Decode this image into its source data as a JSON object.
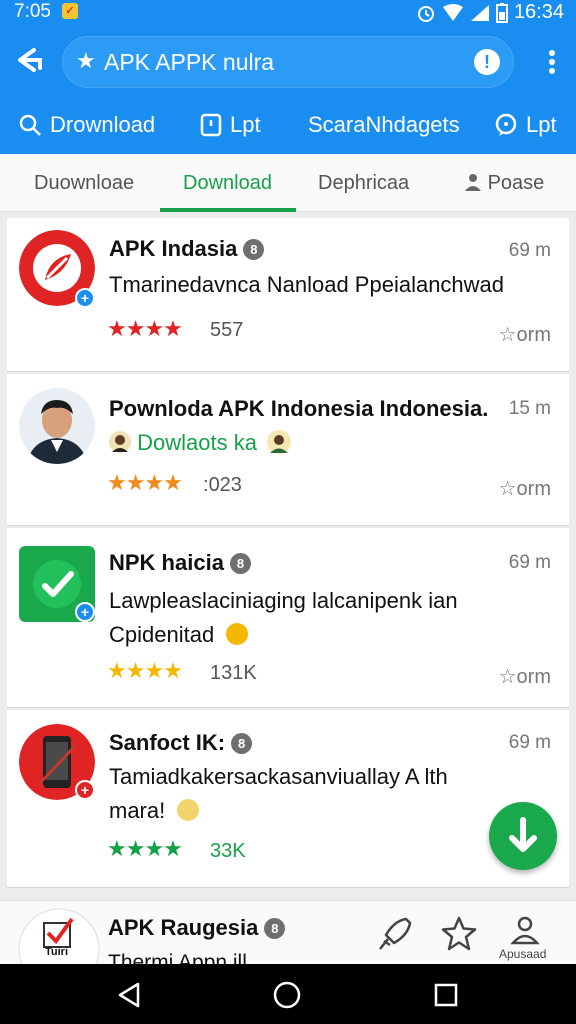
{
  "status": {
    "time": "7:05",
    "clock": "16:34"
  },
  "search": {
    "query": "APK APPK nulra"
  },
  "quickbar": [
    {
      "label": "Drownload",
      "icon": "search-icon"
    },
    {
      "label": "Lpt",
      "icon": "clipboard-icon"
    },
    {
      "label": "ScaraNhdagets",
      "icon": "none"
    },
    {
      "label": "Lpt",
      "icon": "chat-icon"
    }
  ],
  "tabs": [
    {
      "label": "Duownloae",
      "active": false
    },
    {
      "label": "Download",
      "active": true
    },
    {
      "label": "Dephricaa",
      "active": false
    },
    {
      "label": "Poase",
      "active": false,
      "icon": "person-icon"
    }
  ],
  "apps": [
    {
      "title": "APK Indasia",
      "time": "69 m",
      "desc_lines": [
        "Tmarinedavnca Nanload Ppeialanchwad"
      ],
      "rating": 3.5,
      "count": "557",
      "fav": "orm",
      "color": "#e02424"
    },
    {
      "title": "Pownloda APK Indonesia Indonesia.",
      "time": "15 m",
      "desc_lines": [
        "Dowlaots ka"
      ],
      "rating": 3.5,
      "count": "023",
      "fav": "orm",
      "color": "#17a04a"
    },
    {
      "title": "NPK haicia",
      "time": "69 m",
      "desc_lines": [
        "Lawpleaslaciniaging lalcanipenk ian",
        "Cpidenitad"
      ],
      "rating": 4,
      "count": "131K",
      "fav": "orm",
      "color": "#f5b800"
    },
    {
      "title": "Sanfoct IK:",
      "time": "69 m",
      "desc_lines": [
        "Tamiadkakersackasanviuallay A lth",
        "mara!"
      ],
      "rating": 3.5,
      "count": "33K",
      "fav": "",
      "color": "#17a04a"
    }
  ],
  "bottom": {
    "icon_label": "Tuiri",
    "title": "APK Raugesia",
    "subtitle": "Thermi Appn ill",
    "account_label": "Apusaad"
  }
}
